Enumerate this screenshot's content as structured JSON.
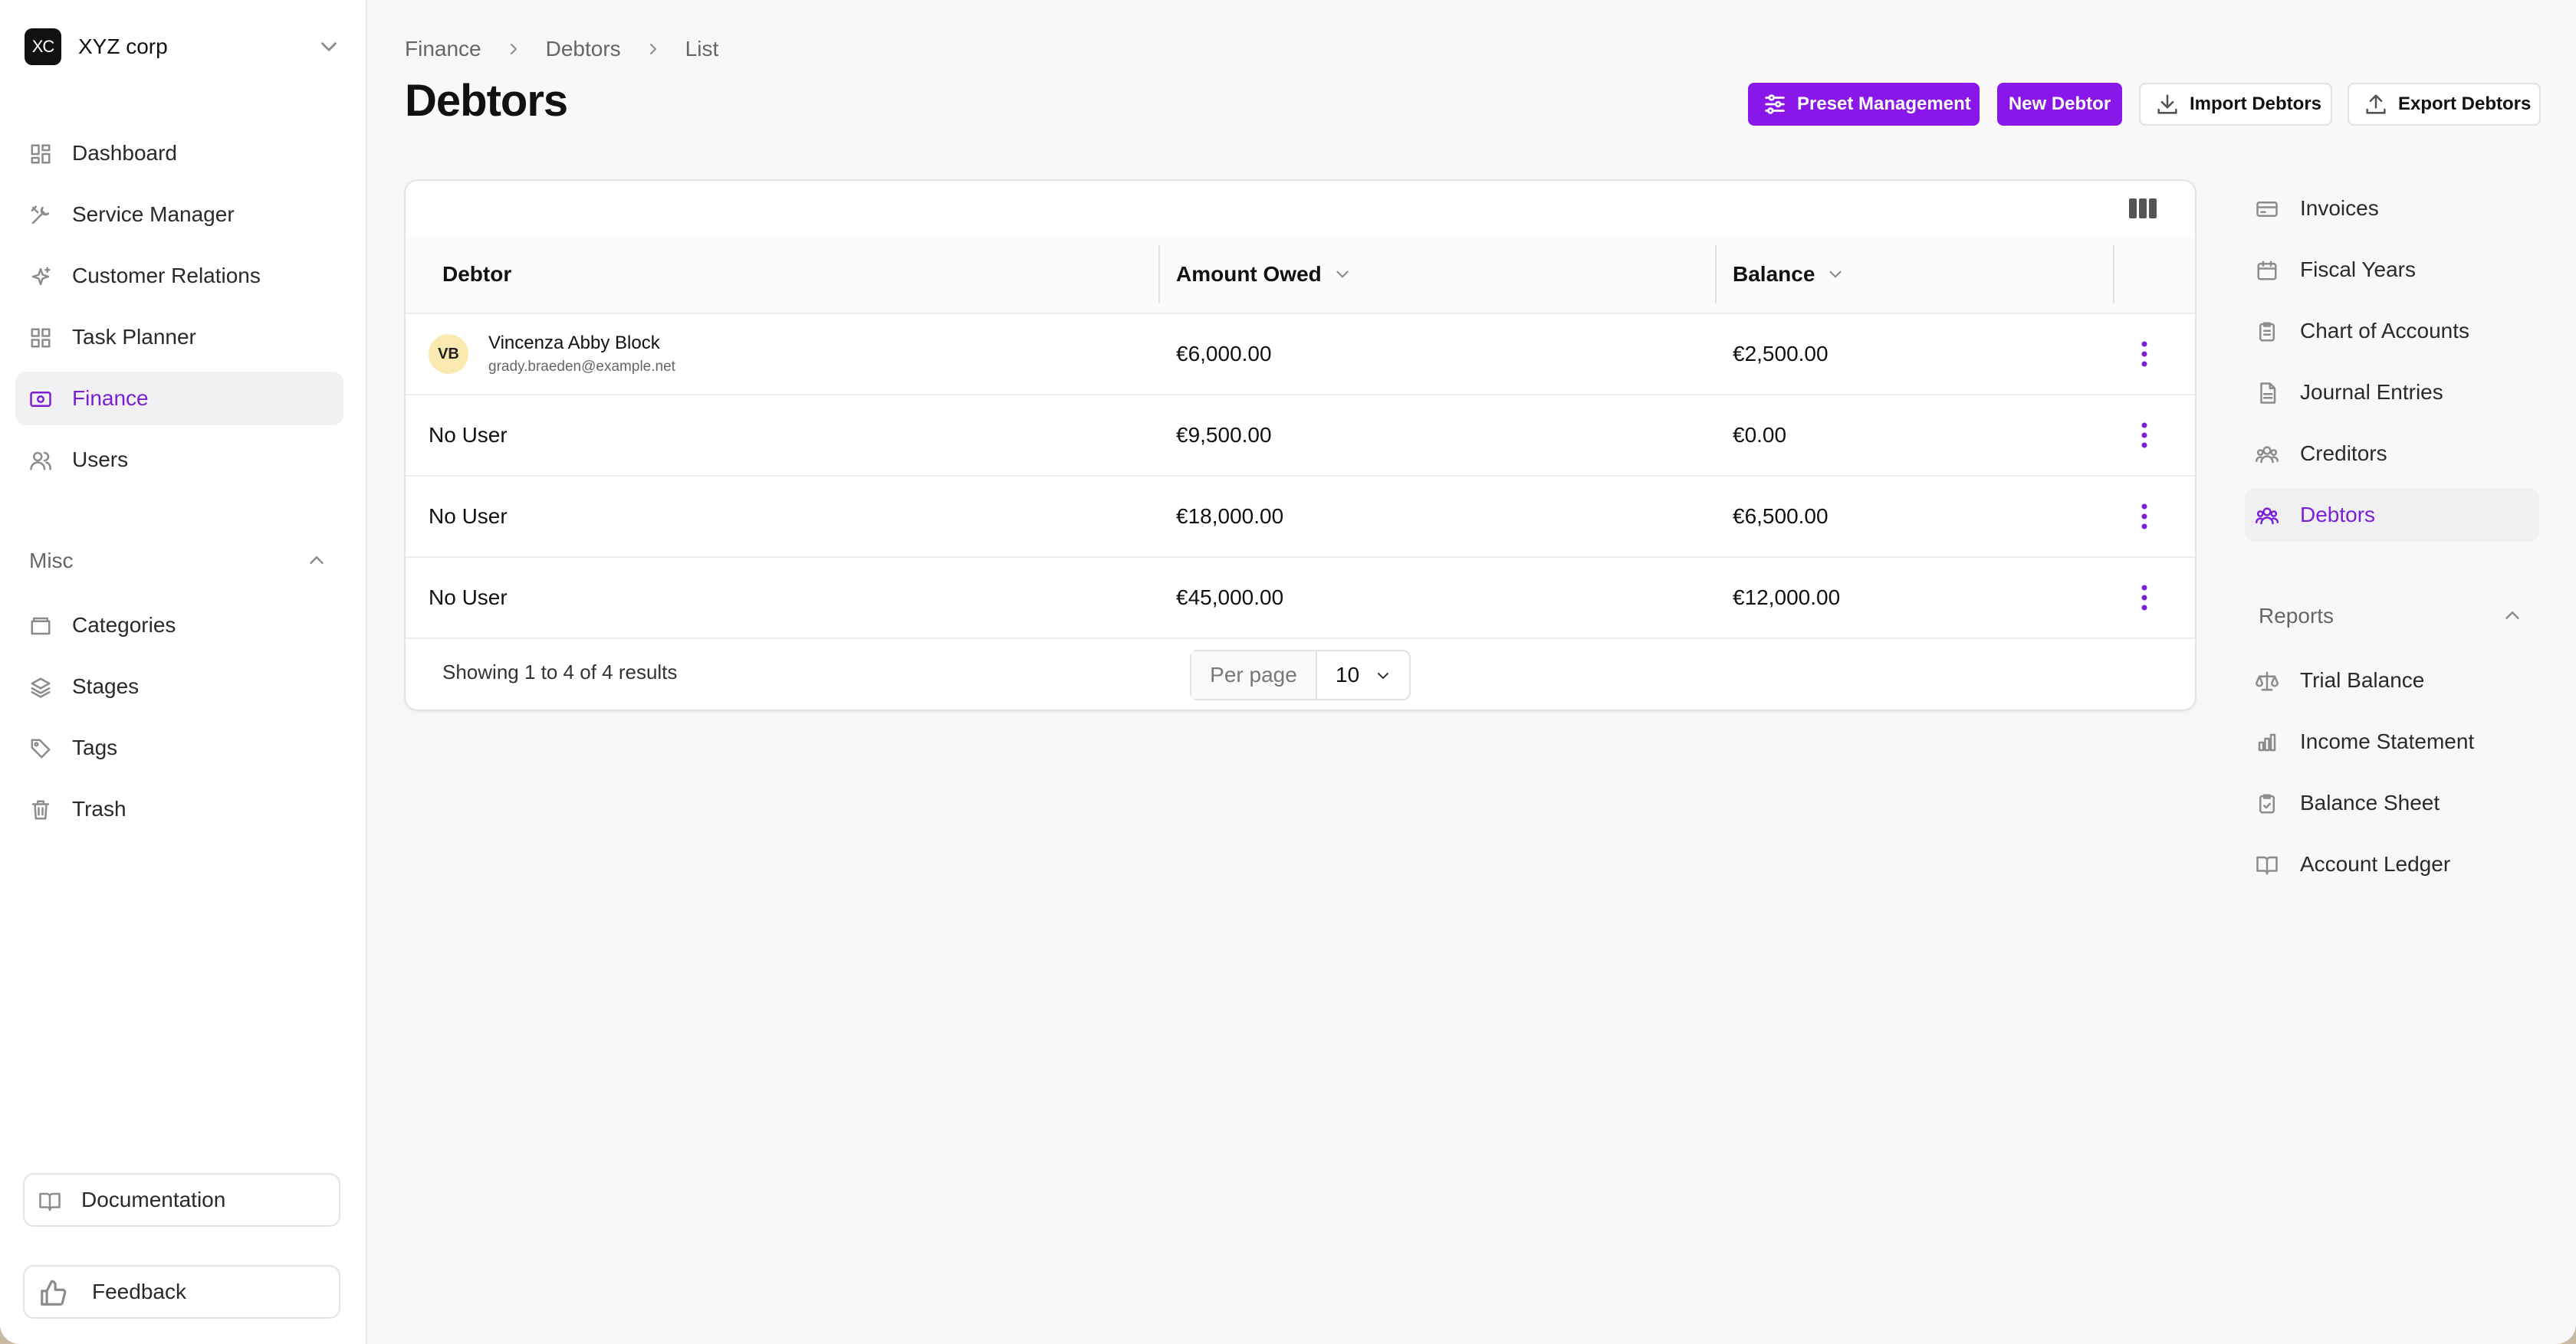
{
  "org": {
    "initials": "XC",
    "name": "XYZ corp"
  },
  "sidebar": {
    "items": [
      {
        "label": "Dashboard",
        "icon": "grid-icon"
      },
      {
        "label": "Service Manager",
        "icon": "tools-icon"
      },
      {
        "label": "Customer Relations",
        "icon": "sparkle-icon"
      },
      {
        "label": "Task Planner",
        "icon": "grid-icon"
      },
      {
        "label": "Finance",
        "icon": "money-icon",
        "active": true
      },
      {
        "label": "Users",
        "icon": "users-icon"
      }
    ],
    "misc_label": "Misc",
    "misc_items": [
      {
        "label": "Categories",
        "icon": "folder-icon"
      },
      {
        "label": "Stages",
        "icon": "layers-icon"
      },
      {
        "label": "Tags",
        "icon": "tag-icon"
      },
      {
        "label": "Trash",
        "icon": "trash-icon"
      }
    ],
    "documentation": "Documentation",
    "feedback": "Feedback"
  },
  "breadcrumb": [
    "Finance",
    "Debtors",
    "List"
  ],
  "page_title": "Debtors",
  "actions": {
    "preset": "Preset Management",
    "new": "New Debtor",
    "import": "Import Debtors",
    "export": "Export Debtors"
  },
  "table": {
    "columns": [
      "Debtor",
      "Amount Owed",
      "Balance"
    ],
    "rows": [
      {
        "initials": "VB",
        "name": "Vincenza Abby Block",
        "email": "grady.braeden@example.net",
        "amount": "€6,000.00",
        "balance": "€2,500.00"
      },
      {
        "name": "No User",
        "amount": "€9,500.00",
        "balance": "€0.00"
      },
      {
        "name": "No User",
        "amount": "€18,000.00",
        "balance": "€6,500.00"
      },
      {
        "name": "No User",
        "amount": "€45,000.00",
        "balance": "€12,000.00"
      }
    ],
    "summary": "Showing 1 to 4 of 4 results",
    "per_page_label": "Per page",
    "per_page_value": "10"
  },
  "subnav": {
    "items": [
      {
        "label": "Invoices",
        "icon": "card-icon"
      },
      {
        "label": "Fiscal Years",
        "icon": "calendar-icon"
      },
      {
        "label": "Chart of Accounts",
        "icon": "clipboard-icon"
      },
      {
        "label": "Journal Entries",
        "icon": "document-icon"
      },
      {
        "label": "Creditors",
        "icon": "users-icon"
      },
      {
        "label": "Debtors",
        "icon": "users-icon",
        "active": true
      }
    ],
    "reports_label": "Reports",
    "reports": [
      {
        "label": "Trial Balance",
        "icon": "scale-icon"
      },
      {
        "label": "Income Statement",
        "icon": "bar-chart-icon"
      },
      {
        "label": "Balance Sheet",
        "icon": "clipboard-icon"
      },
      {
        "label": "Account Ledger",
        "icon": "book-icon"
      }
    ]
  },
  "colors": {
    "accent": "#8a17ea",
    "active_text": "#7b1fd6"
  }
}
